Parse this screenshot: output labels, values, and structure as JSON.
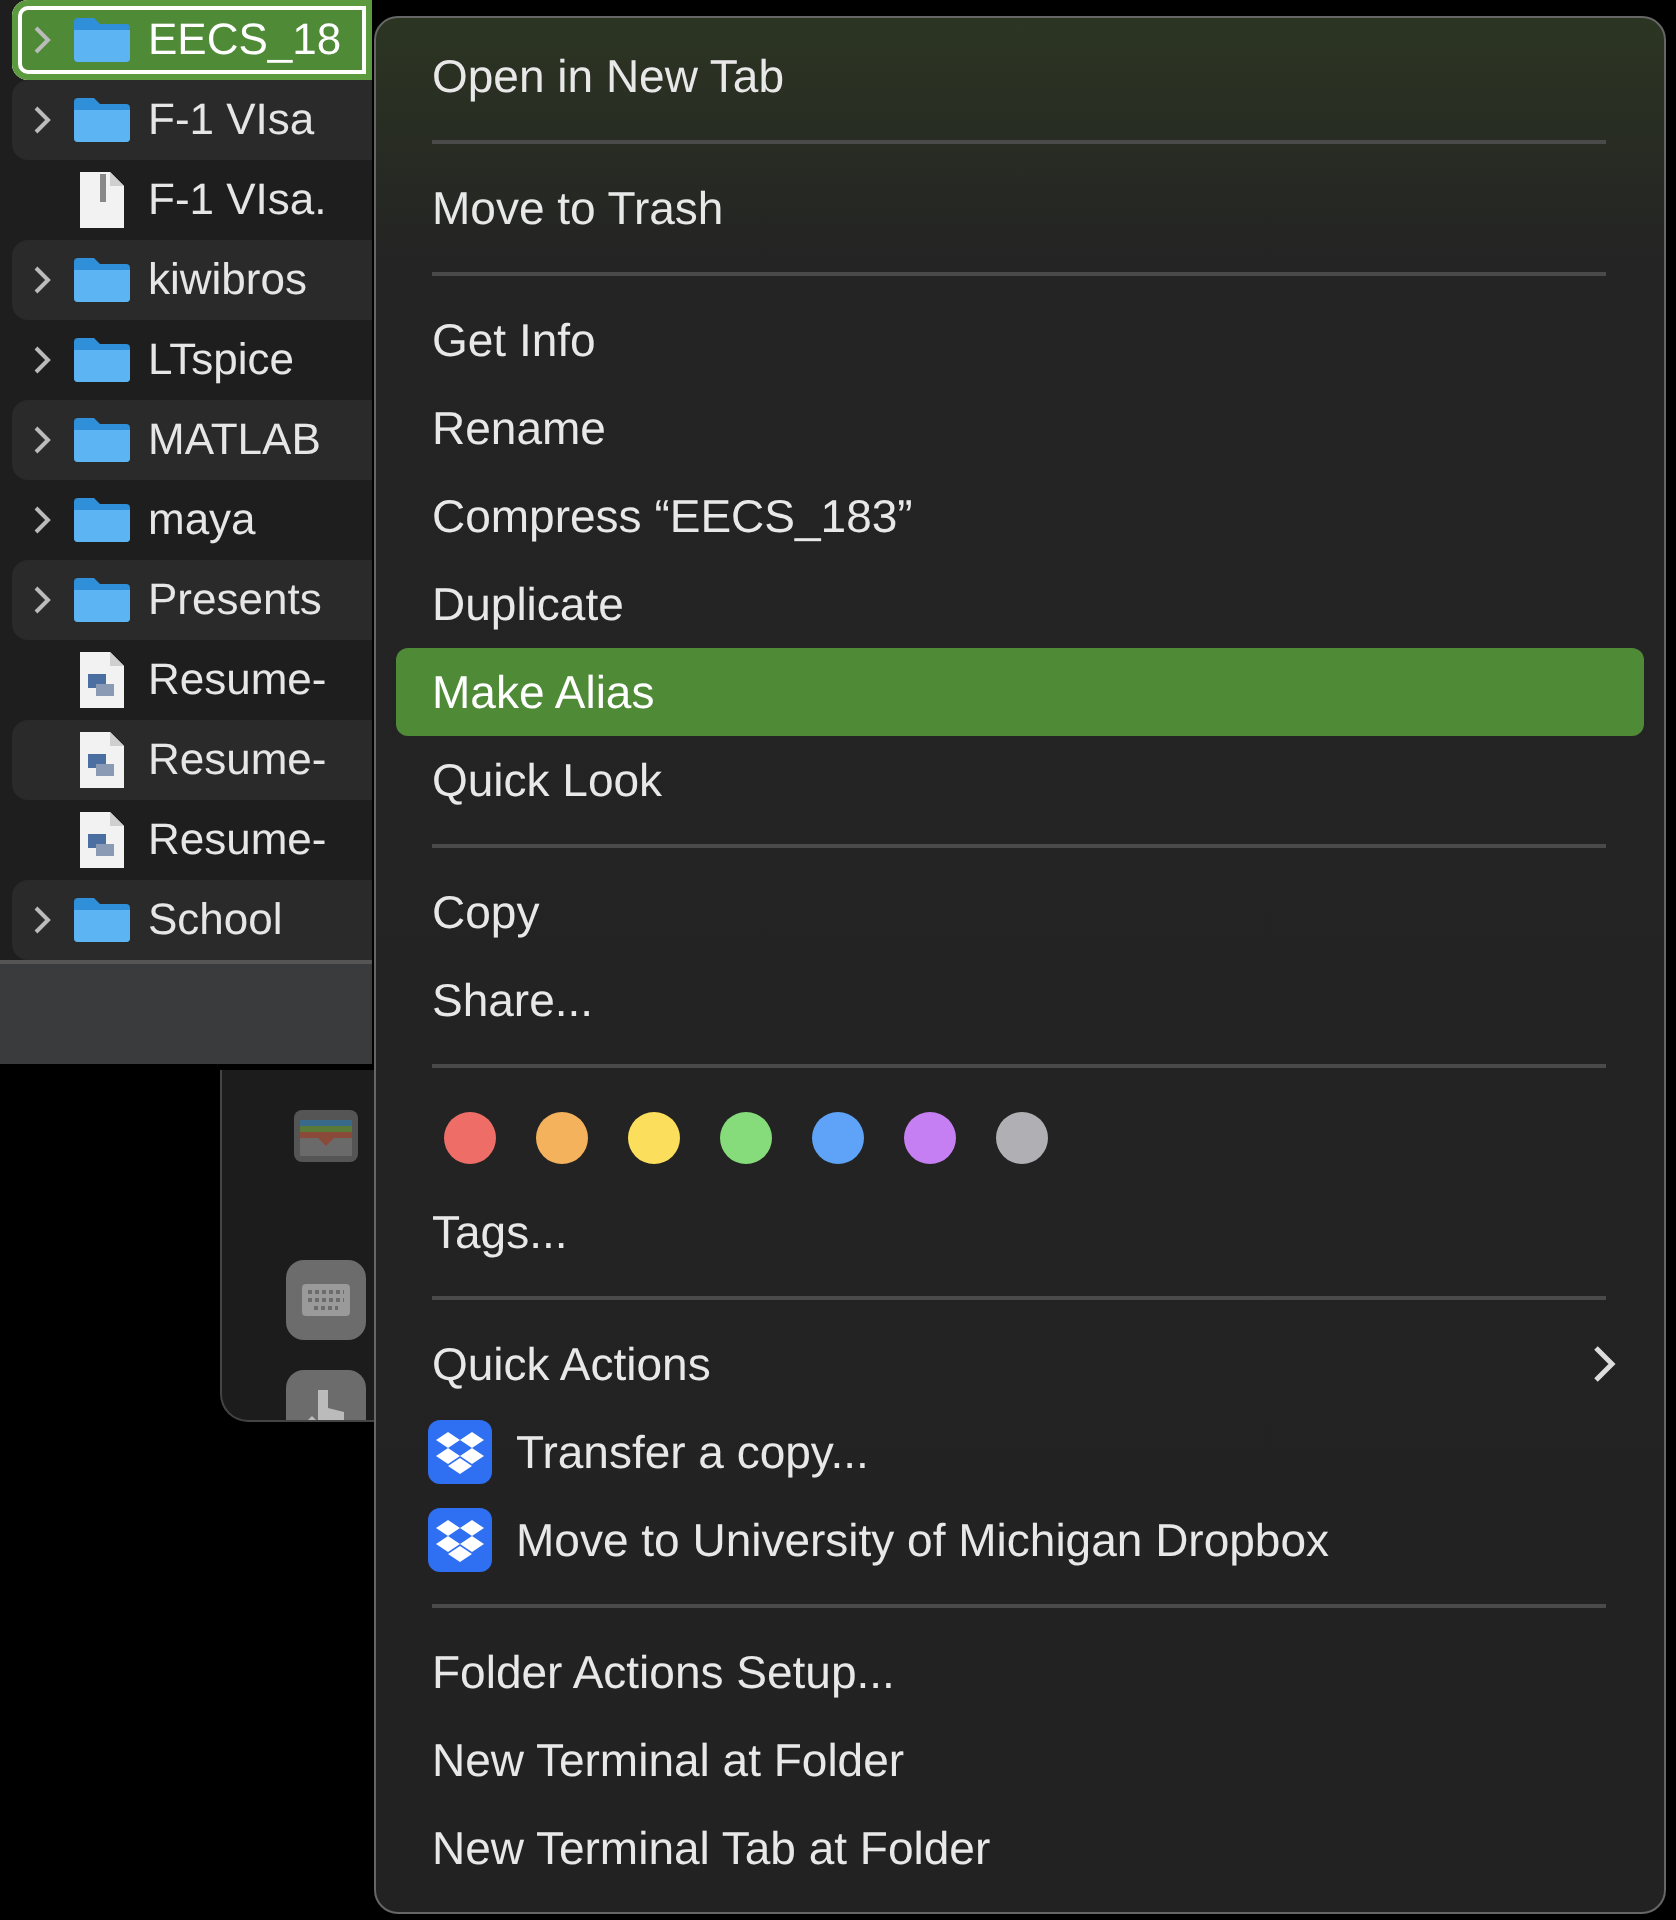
{
  "file_list": {
    "rows": [
      {
        "name": "EECS_18",
        "kind": "folder",
        "selected": true
      },
      {
        "name": "F-1 VIsa",
        "kind": "folder",
        "selected": false
      },
      {
        "name": "F-1 VIsa.",
        "kind": "zip",
        "selected": false
      },
      {
        "name": "kiwibros",
        "kind": "folder",
        "selected": false
      },
      {
        "name": "LTspice",
        "kind": "folder",
        "selected": false
      },
      {
        "name": "MATLAB",
        "kind": "folder",
        "selected": false
      },
      {
        "name": "maya",
        "kind": "folder",
        "selected": false
      },
      {
        "name": "Presents",
        "kind": "folder",
        "selected": false
      },
      {
        "name": "Resume-",
        "kind": "document",
        "selected": false
      },
      {
        "name": "Resume-",
        "kind": "document",
        "selected": false
      },
      {
        "name": "Resume-",
        "kind": "document",
        "selected": false
      },
      {
        "name": "School",
        "kind": "folder",
        "selected": false
      }
    ]
  },
  "context_menu": {
    "items": [
      {
        "kind": "item",
        "label": "Open in New Tab",
        "selected": false
      },
      {
        "kind": "separator"
      },
      {
        "kind": "item",
        "label": "Move to Trash",
        "selected": false
      },
      {
        "kind": "separator"
      },
      {
        "kind": "item",
        "label": "Get Info",
        "selected": false
      },
      {
        "kind": "item",
        "label": "Rename",
        "selected": false
      },
      {
        "kind": "item",
        "label": "Compress “EECS_183”",
        "selected": false
      },
      {
        "kind": "item",
        "label": "Duplicate",
        "selected": false
      },
      {
        "kind": "item",
        "label": "Make Alias",
        "selected": true
      },
      {
        "kind": "item",
        "label": "Quick Look",
        "selected": false
      },
      {
        "kind": "separator"
      },
      {
        "kind": "item",
        "label": "Copy",
        "selected": false
      },
      {
        "kind": "item",
        "label": "Share...",
        "selected": false
      },
      {
        "kind": "separator"
      },
      {
        "kind": "tags",
        "dots": [
          {
            "color": "#ee6e67"
          },
          {
            "color": "#f4b25c"
          },
          {
            "color": "#fbdf5c"
          },
          {
            "color": "#86dc7b"
          },
          {
            "color": "#5ea3f7"
          },
          {
            "color": "#c67ff2"
          },
          {
            "color": "#b0b0b4"
          }
        ]
      },
      {
        "kind": "item",
        "label": "Tags...",
        "selected": false
      },
      {
        "kind": "separator"
      },
      {
        "kind": "submenu",
        "label": "Quick Actions",
        "selected": false
      },
      {
        "kind": "app-item",
        "label": "Transfer a copy...",
        "selected": false
      },
      {
        "kind": "app-item",
        "label": "Move to University of Michigan Dropbox",
        "selected": false
      },
      {
        "kind": "separator"
      },
      {
        "kind": "item",
        "label": "Folder Actions Setup...",
        "selected": false
      },
      {
        "kind": "item",
        "label": "New Terminal at Folder",
        "selected": false
      },
      {
        "kind": "item",
        "label": "New Terminal Tab at Folder",
        "selected": false
      }
    ]
  }
}
